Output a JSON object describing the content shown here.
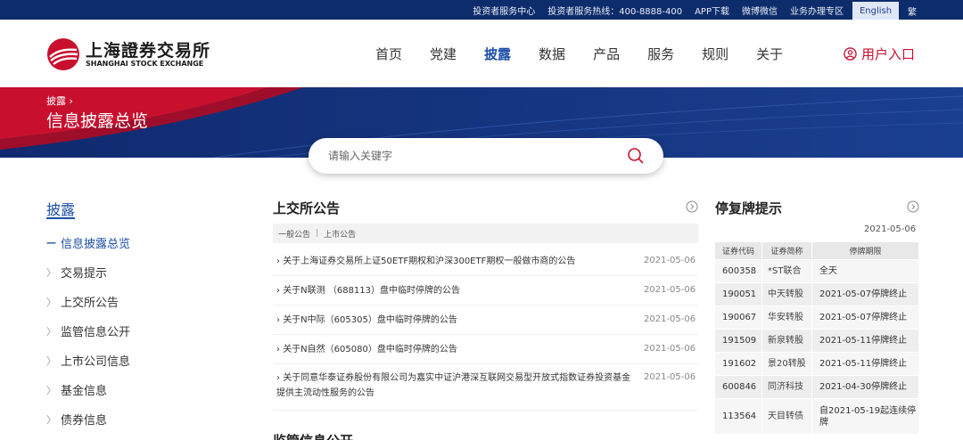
{
  "topbar": {
    "links": [
      "投资者服务中心",
      "投资者服务热线：400-8888-400",
      "APP下载",
      "微博微信",
      "业务办理专区"
    ],
    "lang_en": "English",
    "lang_zh": "繁"
  },
  "logo": {
    "cn": "上海證券交易所",
    "en": "SHANGHAI STOCK EXCHANGE"
  },
  "nav": {
    "items": [
      "首页",
      "党建",
      "披露",
      "数据",
      "产品",
      "服务",
      "规则",
      "关于"
    ],
    "active": "披露",
    "user_entry": "用户入口"
  },
  "banner": {
    "breadcrumb": "披露 ›",
    "title": "信息披露总览"
  },
  "search": {
    "placeholder": "请输入关键字"
  },
  "sidebar": {
    "title": "披露",
    "items": [
      "信息披露总览",
      "交易提示",
      "上交所公告",
      "监管信息公开",
      "上市公司信息",
      "基金信息",
      "债券信息"
    ],
    "active_index": 0
  },
  "announcements": {
    "title": "上交所公告",
    "tabs": [
      "一般公告",
      "上市公告"
    ],
    "rows": [
      {
        "text": "关于上海证券交易所上证50ETF期权和沪深300ETF期权一般做市商的公告",
        "date": "2021-05-06"
      },
      {
        "text": "关于N联测 （688113）盘中临时停牌的公告",
        "date": "2021-05-06"
      },
      {
        "text": "关于N中际（605305）盘中临时停牌的公告",
        "date": "2021-05-06"
      },
      {
        "text": "关于N自然（605080）盘中临时停牌的公告",
        "date": "2021-05-06"
      },
      {
        "text": "关于同意华泰证券股份有限公司为嘉实中证沪港深互联网交易型开放式指数证券投资基金提供主流动性服务的公告",
        "date": "2021-05-06"
      }
    ]
  },
  "suspension": {
    "title": "停复牌提示",
    "date": "2021-05-06",
    "headers": [
      "证券代码",
      "证券简称",
      "停牌期限"
    ],
    "rows": [
      {
        "code": "600358",
        "name": "*ST联合",
        "period": "全天"
      },
      {
        "code": "190051",
        "name": "中天转股",
        "period": "2021-05-07停牌终止"
      },
      {
        "code": "190067",
        "name": "华安转股",
        "period": "2021-05-07停牌终止"
      },
      {
        "code": "191509",
        "name": "新泉转股",
        "period": "2021-05-11停牌终止"
      },
      {
        "code": "191602",
        "name": "景20转股",
        "period": "2021-05-11停牌终止"
      },
      {
        "code": "600846",
        "name": "同济科技",
        "period": "2021-04-30停牌终止"
      },
      {
        "code": "113564",
        "name": "天目转债",
        "period": "自2021-05-19起连续停牌"
      }
    ]
  },
  "next_section": {
    "title": "监管信息公开"
  },
  "colors": {
    "brand_red": "#c8102e",
    "brand_blue": "#1d4fa8",
    "topbar_bg": "#0d2c6b"
  }
}
